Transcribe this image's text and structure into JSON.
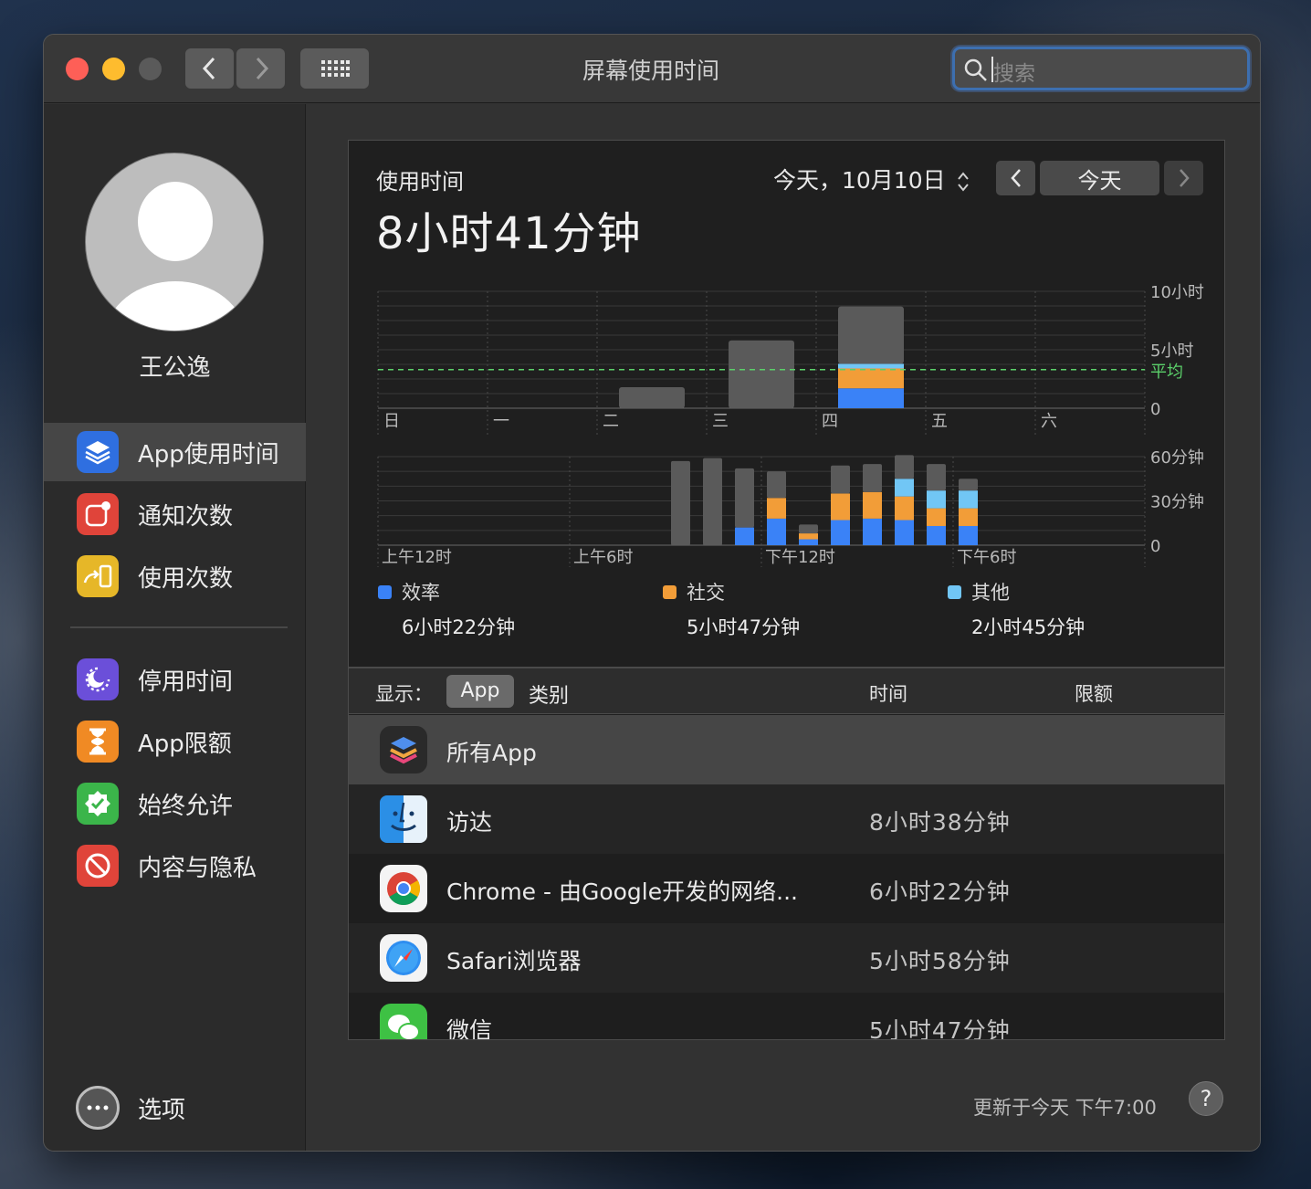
{
  "window": {
    "title": "屏幕使用时间",
    "search_placeholder": "搜索"
  },
  "user": {
    "name": "王公逸"
  },
  "sidebar": {
    "group1": [
      {
        "label": "App使用时间",
        "icon": "layers-icon",
        "color": "#2f6fe0",
        "selected": true
      },
      {
        "label": "通知次数",
        "icon": "notification-badge-icon",
        "color": "#e0443a"
      },
      {
        "label": "使用次数",
        "icon": "pickup-phone-icon",
        "color": "#e6b728"
      }
    ],
    "group2": [
      {
        "label": "停用时间",
        "icon": "downtime-moon-icon",
        "color": "#6b4fd9"
      },
      {
        "label": "App限额",
        "icon": "hourglass-icon",
        "color": "#f08a24"
      },
      {
        "label": "始终允许",
        "icon": "checkmark-badge-icon",
        "color": "#3bb54a"
      },
      {
        "label": "内容与隐私",
        "icon": "restricted-icon",
        "color": "#e0443a"
      }
    ],
    "options_label": "选项"
  },
  "usage": {
    "title": "使用时间",
    "total": "8小时41分钟",
    "date_label": "今天，10月10日",
    "today_button": "今天"
  },
  "chart_data": [
    {
      "type": "bar",
      "title": "weekly",
      "categories": [
        "日",
        "一",
        "二",
        "三",
        "四",
        "五",
        "六"
      ],
      "series": [
        {
          "name": "效率",
          "values": [
            0,
            0,
            0,
            0,
            1.7,
            0,
            0
          ]
        },
        {
          "name": "社交",
          "values": [
            0,
            0,
            0,
            0,
            1.7,
            0,
            0
          ]
        },
        {
          "name": "其他",
          "values": [
            0,
            0,
            0,
            0,
            0.4,
            0,
            0
          ]
        },
        {
          "values": [
            0,
            0,
            1.8,
            5.8,
            4.9,
            0,
            0
          ]
        }
      ],
      "totals": [
        0,
        0,
        1.8,
        5.8,
        8.7,
        0,
        0
      ],
      "average": 3.3,
      "average_label": "平均",
      "ytick_labels": [
        "10小时",
        "5小时",
        "0"
      ],
      "ylim": [
        0,
        10
      ]
    },
    {
      "type": "bar",
      "title": "hourly",
      "xtick_labels": [
        "上午12时",
        "上午6时",
        "下午12时",
        "下午6时"
      ],
      "hours": [
        9,
        10,
        11,
        12,
        13,
        14,
        15,
        16,
        17,
        18
      ],
      "series": [
        {
          "name": "效率",
          "values": [
            0,
            0,
            12,
            18,
            4,
            17,
            18,
            17,
            13,
            13
          ]
        },
        {
          "name": "社交",
          "values": [
            0,
            0,
            0,
            14,
            4,
            18,
            18,
            16,
            12,
            12
          ]
        },
        {
          "name": "其他",
          "values": [
            0,
            0,
            0,
            0,
            0,
            0,
            0,
            12,
            12,
            12
          ]
        },
        {
          "values": [
            57,
            59,
            40,
            18,
            6,
            19,
            19,
            16,
            18,
            8
          ]
        }
      ],
      "ytick_labels": [
        "60分钟",
        "30分钟",
        "0"
      ],
      "ylim": [
        0,
        60
      ]
    }
  ],
  "legend": [
    {
      "name": "效率",
      "value": "6小时22分钟",
      "color": "#3a82f7"
    },
    {
      "name": "社交",
      "value": "5小时47分钟",
      "color": "#f29d38"
    },
    {
      "name": "其他",
      "value": "2小时45分钟",
      "color": "#71c6f5"
    }
  ],
  "table": {
    "show_label": "显示：",
    "seg_app": "App",
    "seg_category": "类别",
    "col_time": "时间",
    "col_limit": "限额",
    "rows": [
      {
        "name": "所有App",
        "time": "",
        "icon": "all-apps-icon"
      },
      {
        "name": "访达",
        "time": "8小时38分钟",
        "icon": "finder-icon"
      },
      {
        "name": "Chrome - 由Google开发的网络...",
        "time": "6小时22分钟",
        "icon": "chrome-icon"
      },
      {
        "name": "Safari浏览器",
        "time": "5小时58分钟",
        "icon": "safari-icon"
      },
      {
        "name": "微信",
        "time": "5小时47分钟",
        "icon": "wechat-icon"
      }
    ]
  },
  "footer": {
    "updated": "更新于今天 下午7:00",
    "help": "?"
  }
}
